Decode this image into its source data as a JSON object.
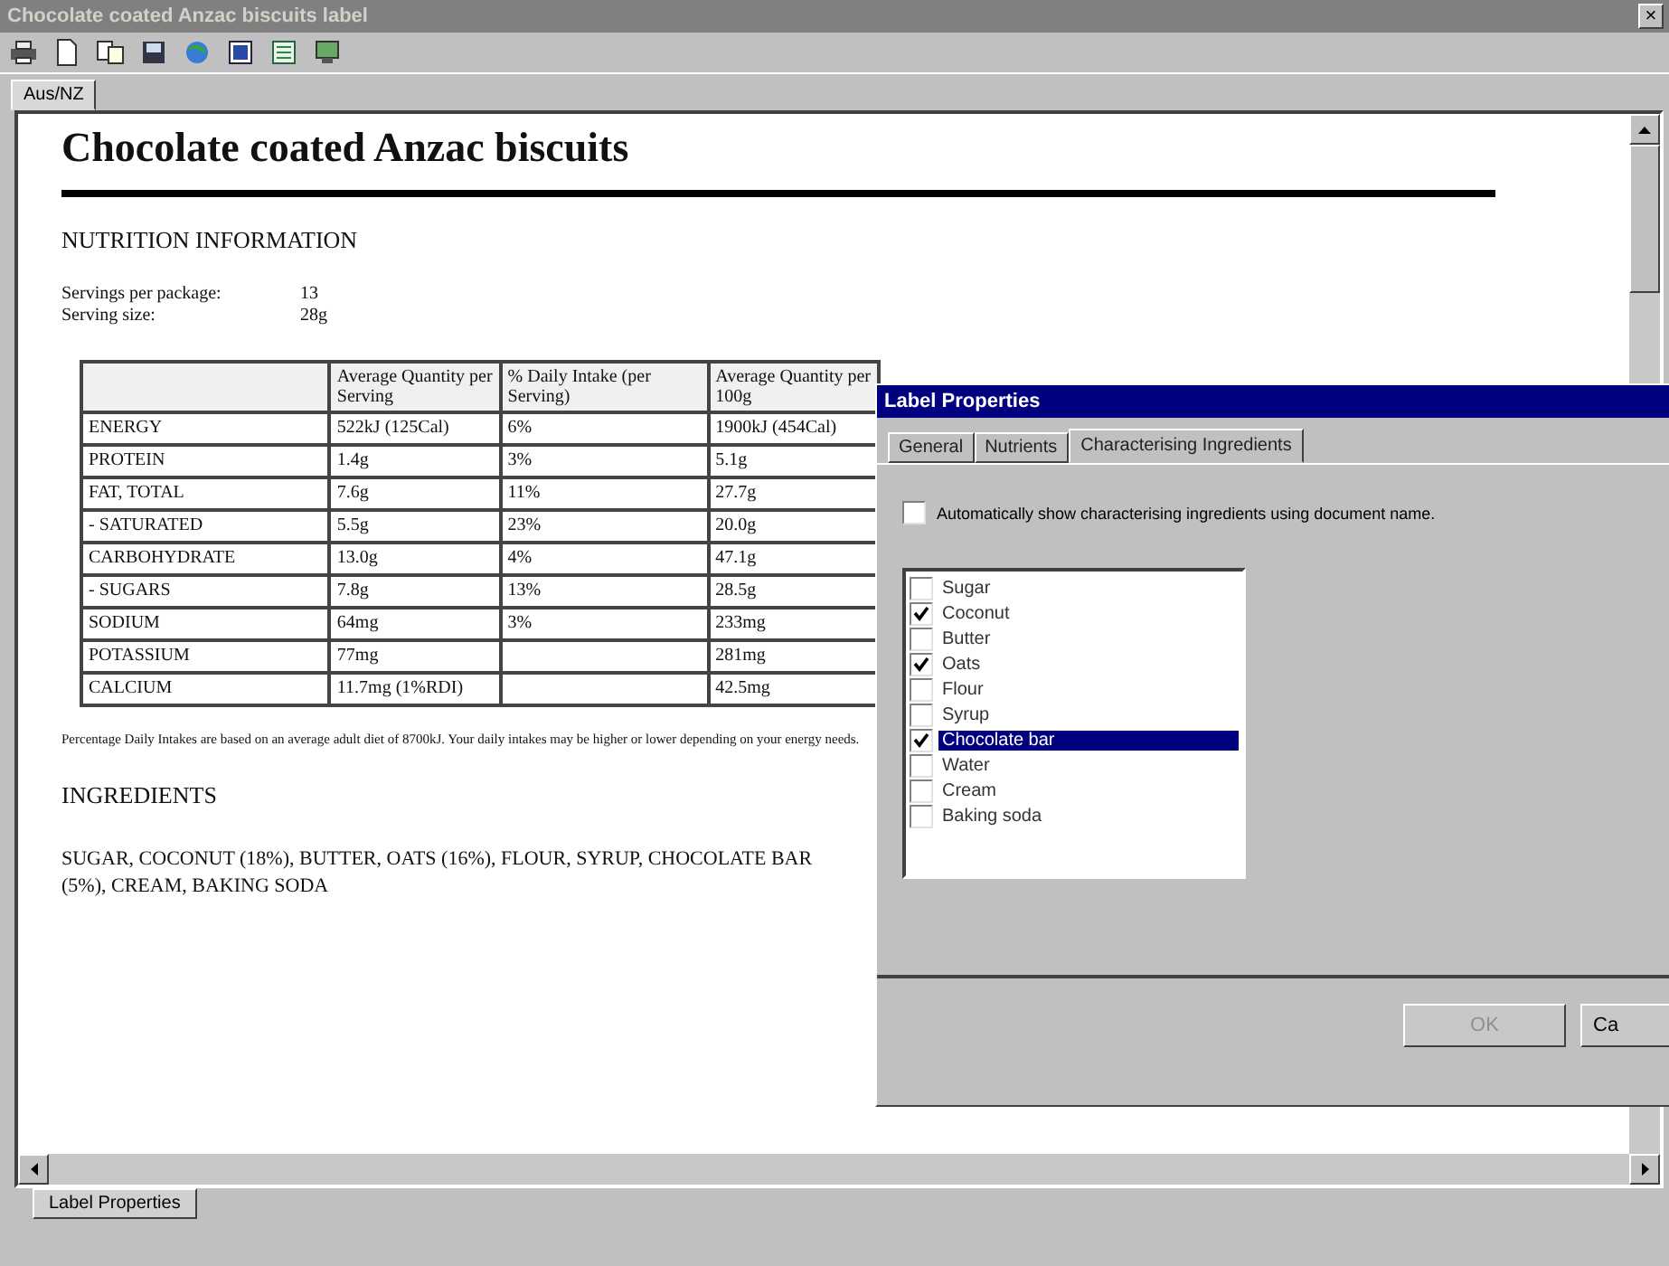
{
  "window": {
    "title": "Chocolate coated Anzac biscuits label",
    "close": "×"
  },
  "toolbar": [
    {
      "kind": "printer"
    },
    {
      "kind": "page"
    },
    {
      "kind": "copy"
    },
    {
      "kind": "save"
    },
    {
      "kind": "globe"
    },
    {
      "kind": "word"
    },
    {
      "kind": "sheet"
    },
    {
      "kind": "monitor"
    }
  ],
  "doc_tabs": [
    {
      "label": "Aus/NZ",
      "selected": true
    }
  ],
  "document": {
    "title": "Chocolate coated Anzac biscuits",
    "section": "NUTRITION INFORMATION",
    "servings": [
      {
        "label": "Servings per package:",
        "value": "13"
      },
      {
        "label": "Serving size:",
        "value": "28g"
      }
    ],
    "table": {
      "columns": [
        "",
        "Average Quantity per Serving",
        "% Daily Intake (per Serving)",
        "Average Quantity per 100g"
      ],
      "rows": [
        [
          "ENERGY",
          "522kJ (125Cal)",
          "6%",
          "1900kJ (454Cal)"
        ],
        [
          "PROTEIN",
          "1.4g",
          "3%",
          "5.1g"
        ],
        [
          "FAT, TOTAL",
          "7.6g",
          "11%",
          "27.7g"
        ],
        [
          "- SATURATED",
          "5.5g",
          "23%",
          "20.0g"
        ],
        [
          "CARBOHYDRATE",
          "13.0g",
          "4%",
          "47.1g"
        ],
        [
          "- SUGARS",
          "7.8g",
          "13%",
          "28.5g"
        ],
        [
          "SODIUM",
          "64mg",
          "3%",
          "233mg"
        ],
        [
          "POTASSIUM",
          "77mg",
          "",
          "281mg"
        ],
        [
          "CALCIUM",
          "11.7mg (1%RDI)",
          "",
          "42.5mg"
        ]
      ]
    },
    "footnote": "Percentage Daily Intakes are based on an average adult diet of 8700kJ. Your daily intakes may be higher or lower depending on your energy needs.",
    "ingredients_heading": "INGREDIENTS",
    "ingredients": "SUGAR, COCONUT (18%), BUTTER, OATS (16%), FLOUR, SYRUP, CHOCOLATE BAR (5%), CREAM, BAKING SODA"
  },
  "bottom_tabs": [
    {
      "label": "Label Properties",
      "selected": true
    }
  ],
  "dialog": {
    "title": "Label Properties",
    "tabs": [
      {
        "label": "General",
        "selected": false
      },
      {
        "label": "Nutrients",
        "selected": false
      },
      {
        "label": "Characterising Ingredients",
        "selected": true
      }
    ],
    "auto_option": {
      "label": "Automatically show characterising ingredients using document name.",
      "checked": false
    },
    "ingredients": [
      {
        "label": "Sugar",
        "checked": false,
        "selected": false
      },
      {
        "label": "Coconut",
        "checked": true,
        "selected": false
      },
      {
        "label": "Butter",
        "checked": false,
        "selected": false
      },
      {
        "label": "Oats",
        "checked": true,
        "selected": false
      },
      {
        "label": "Flour",
        "checked": false,
        "selected": false
      },
      {
        "label": "Syrup",
        "checked": false,
        "selected": false
      },
      {
        "label": "Chocolate bar",
        "checked": true,
        "selected": true
      },
      {
        "label": "Water",
        "checked": false,
        "selected": false
      },
      {
        "label": "Cream",
        "checked": false,
        "selected": false
      },
      {
        "label": "Baking soda",
        "checked": false,
        "selected": false
      }
    ],
    "buttons": [
      {
        "label": "OK",
        "disabled": true
      },
      {
        "label": "Ca",
        "disabled": false
      }
    ]
  }
}
